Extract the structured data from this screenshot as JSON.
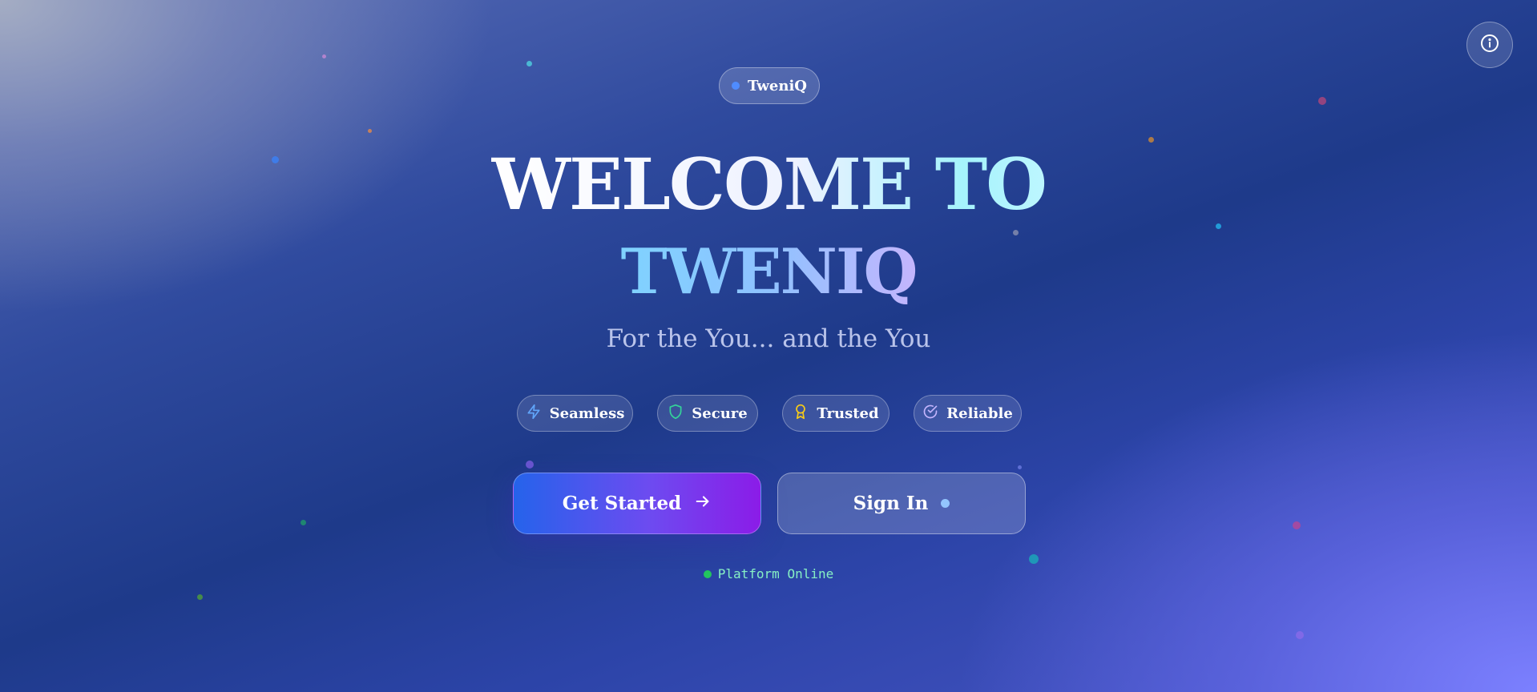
{
  "brand": {
    "name": "TweniQ"
  },
  "hero": {
    "title_line1": "WELCOME TO",
    "title_line2": "TWENIQ",
    "subtitle": "For the You... and the You"
  },
  "features": [
    {
      "label": "Seamless",
      "icon": "lightning-icon",
      "color": "#60a5fa"
    },
    {
      "label": "Secure",
      "icon": "shield-icon",
      "color": "#34d399"
    },
    {
      "label": "Trusted",
      "icon": "award-icon",
      "color": "#facc15"
    },
    {
      "label": "Reliable",
      "icon": "check-circle-icon",
      "color": "#c4b5fd"
    }
  ],
  "actions": {
    "primary_label": "Get Started",
    "secondary_label": "Sign In"
  },
  "status": {
    "text": "Platform Online",
    "color": "#22c55e"
  },
  "colors": {
    "accent_blue": "#2563eb",
    "accent_purple": "#8b1ce8",
    "background_deep": "#1e3a8a"
  }
}
